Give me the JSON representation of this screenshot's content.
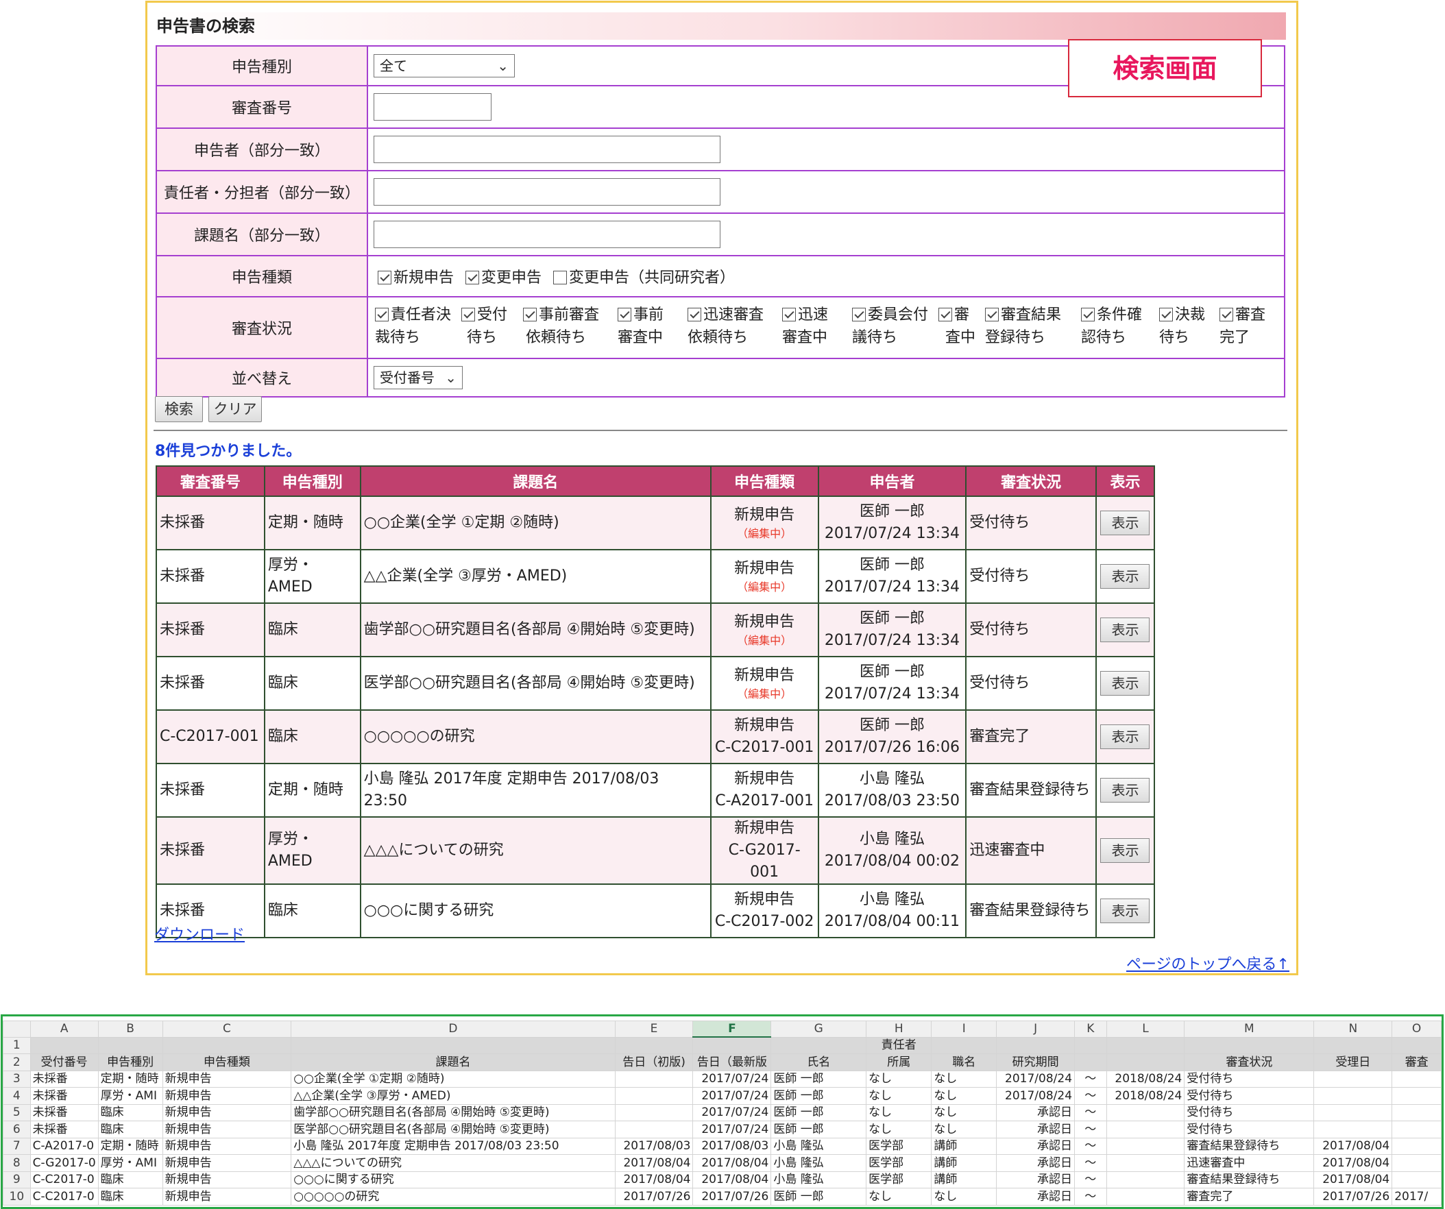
{
  "search": {
    "title": "申告書の検索",
    "callout": "検索画面",
    "labels": {
      "type": "申告種別",
      "review_no": "審査番号",
      "applicant": "申告者（部分一致）",
      "responsible": "責任者・分担者（部分一致）",
      "subject": "課題名（部分一致）",
      "kind": "申告種類",
      "status": "審査状況",
      "sort": "並べ替え"
    },
    "type_value": "全て",
    "sort_value": "受付番号",
    "kinds": [
      {
        "label": "新規申告",
        "checked": true
      },
      {
        "label": "変更申告",
        "checked": true
      },
      {
        "label": "変更申告（共同研究者）",
        "checked": false
      }
    ],
    "statuses": [
      {
        "line1": "責任者決",
        "line2": "裁待ち"
      },
      {
        "line1": "受付",
        "line2": "待ち"
      },
      {
        "line1": "事前審査",
        "line2": "依頼待ち"
      },
      {
        "line1": "事前",
        "line2": "審査中"
      },
      {
        "line1": "迅速審査",
        "line2": "依頼待ち"
      },
      {
        "line1": "迅速",
        "line2": "審査中"
      },
      {
        "line1": "委員会付",
        "line2": "議待ち"
      },
      {
        "line1": "審",
        "line2": "査中"
      },
      {
        "line1": "審査結果",
        "line2": "登録待ち"
      },
      {
        "line1": "条件確",
        "line2": "認待ち"
      },
      {
        "line1": "決裁",
        "line2": "待ち"
      },
      {
        "line1": "審査",
        "line2": "完了"
      }
    ],
    "search_button": "検索",
    "clear_button": "クリア"
  },
  "results": {
    "message": "8件見つかりました。",
    "headers": [
      "審査番号",
      "申告種別",
      "課題名",
      "申告種類",
      "申告者",
      "審査状況",
      "表示"
    ],
    "show_label": "表示",
    "rows": [
      {
        "no": "未採番",
        "type": "定期・随時",
        "subject": "○○企業(全学 ①定期 ②随時)",
        "kind": "新規申告",
        "kind_sub": "（編集中）",
        "name": "医師 一郎",
        "date": "2017/07/24 13:34",
        "status": "受付待ち"
      },
      {
        "no": "未採番",
        "type": "厚労・AMED",
        "subject": "△△企業(全学 ③厚労・AMED)",
        "kind": "新規申告",
        "kind_sub": "（編集中）",
        "name": "医師 一郎",
        "date": "2017/07/24 13:34",
        "status": "受付待ち"
      },
      {
        "no": "未採番",
        "type": "臨床",
        "subject": "歯学部○○研究題目名(各部局 ④開始時 ⑤変更時)",
        "kind": "新規申告",
        "kind_sub": "（編集中）",
        "name": "医師 一郎",
        "date": "2017/07/24 13:34",
        "status": "受付待ち"
      },
      {
        "no": "未採番",
        "type": "臨床",
        "subject": "医学部○○研究題目名(各部局 ④開始時 ⑤変更時)",
        "kind": "新規申告",
        "kind_sub": "（編集中）",
        "name": "医師 一郎",
        "date": "2017/07/24 13:34",
        "status": "受付待ち"
      },
      {
        "no": "C-C2017-001",
        "type": "臨床",
        "subject": "○○○○○の研究",
        "kind": "新規申告",
        "kind_code": "C-C2017-001",
        "name": "医師 一郎",
        "date": "2017/07/26 16:06",
        "status": "審査完了"
      },
      {
        "no": "未採番",
        "type": "定期・随時",
        "subject": "小島 隆弘 2017年度 定期申告 2017/08/03 23:50",
        "kind": "新規申告",
        "kind_code": "C-A2017-001",
        "name": "小島 隆弘",
        "date": "2017/08/03 23:50",
        "status": "審査結果登録待ち"
      },
      {
        "no": "未採番",
        "type": "厚労・AMED",
        "subject": "△△△についての研究",
        "kind": "新規申告",
        "kind_code": "C-G2017-001",
        "name": "小島 隆弘",
        "date": "2017/08/04 00:02",
        "status": "迅速審査中"
      },
      {
        "no": "未採番",
        "type": "臨床",
        "subject": "○○○に関する研究",
        "kind": "新規申告",
        "kind_code": "C-C2017-002",
        "name": "小島 隆弘",
        "date": "2017/08/04 00:11",
        "status": "審査結果登録待ち"
      }
    ],
    "download_link": "ダウンロード",
    "top_link": "ページのトップへ戻る↑"
  },
  "sheet": {
    "columns": [
      "A",
      "B",
      "C",
      "D",
      "E",
      "F",
      "G",
      "H",
      "I",
      "J",
      "K",
      "L",
      "M",
      "N",
      "O"
    ],
    "selected_column": "F",
    "header_row1": {
      "H": "責任者"
    },
    "header_row": [
      "受付番号",
      "申告種別",
      "申告種類",
      "課題名",
      "告日（初版)",
      "告日（最新版",
      "氏名",
      "所属",
      "職名",
      "研究期間",
      "",
      "",
      "審査状況",
      "受理日",
      "審査"
    ],
    "rows": [
      [
        "未採番",
        "定期・随時",
        "新規申告",
        "○○企業(全学 ①定期 ②随時)",
        "",
        "2017/07/24",
        "医師 一郎",
        "なし",
        "なし",
        "2017/08/24",
        "～",
        "2018/08/24",
        "受付待ち",
        "",
        ""
      ],
      [
        "未採番",
        "厚労・AMI",
        "新規申告",
        "△△企業(全学 ③厚労・AMED)",
        "",
        "2017/07/24",
        "医師 一郎",
        "なし",
        "なし",
        "2017/08/24",
        "～",
        "2018/08/24",
        "受付待ち",
        "",
        ""
      ],
      [
        "未採番",
        "臨床",
        "新規申告",
        "歯学部○○研究題目名(各部局 ④開始時 ⑤変更時)",
        "",
        "2017/07/24",
        "医師 一郎",
        "なし",
        "なし",
        "承認日",
        "～",
        "",
        "受付待ち",
        "",
        ""
      ],
      [
        "未採番",
        "臨床",
        "新規申告",
        "医学部○○研究題目名(各部局 ④開始時 ⑤変更時)",
        "",
        "2017/07/24",
        "医師 一郎",
        "なし",
        "なし",
        "承認日",
        "～",
        "",
        "受付待ち",
        "",
        ""
      ],
      [
        "C-A2017-0",
        "定期・随時",
        "新規申告",
        "小島 隆弘 2017年度 定期申告 2017/08/03 23:50",
        "2017/08/03",
        "2017/08/03",
        "小島 隆弘",
        "医学部",
        "講師",
        "承認日",
        "～",
        "",
        "審査結果登録待ち",
        "2017/08/04",
        ""
      ],
      [
        "C-G2017-0",
        "厚労・AMI",
        "新規申告",
        "△△△についての研究",
        "2017/08/04",
        "2017/08/04",
        "小島 隆弘",
        "医学部",
        "講師",
        "承認日",
        "～",
        "",
        "迅速審査中",
        "2017/08/04",
        ""
      ],
      [
        "C-C2017-0",
        "臨床",
        "新規申告",
        "○○○に関する研究",
        "2017/08/04",
        "2017/08/04",
        "小島 隆弘",
        "医学部",
        "講師",
        "承認日",
        "～",
        "",
        "審査結果登録待ち",
        "2017/08/04",
        ""
      ],
      [
        "C-C2017-0",
        "臨床",
        "新規申告",
        "○○○○○の研究",
        "2017/07/26",
        "2017/07/26",
        "医師 一郎",
        "なし",
        "なし",
        "承認日",
        "～",
        "",
        "審査完了",
        "2017/07/26",
        "2017/"
      ]
    ]
  }
}
